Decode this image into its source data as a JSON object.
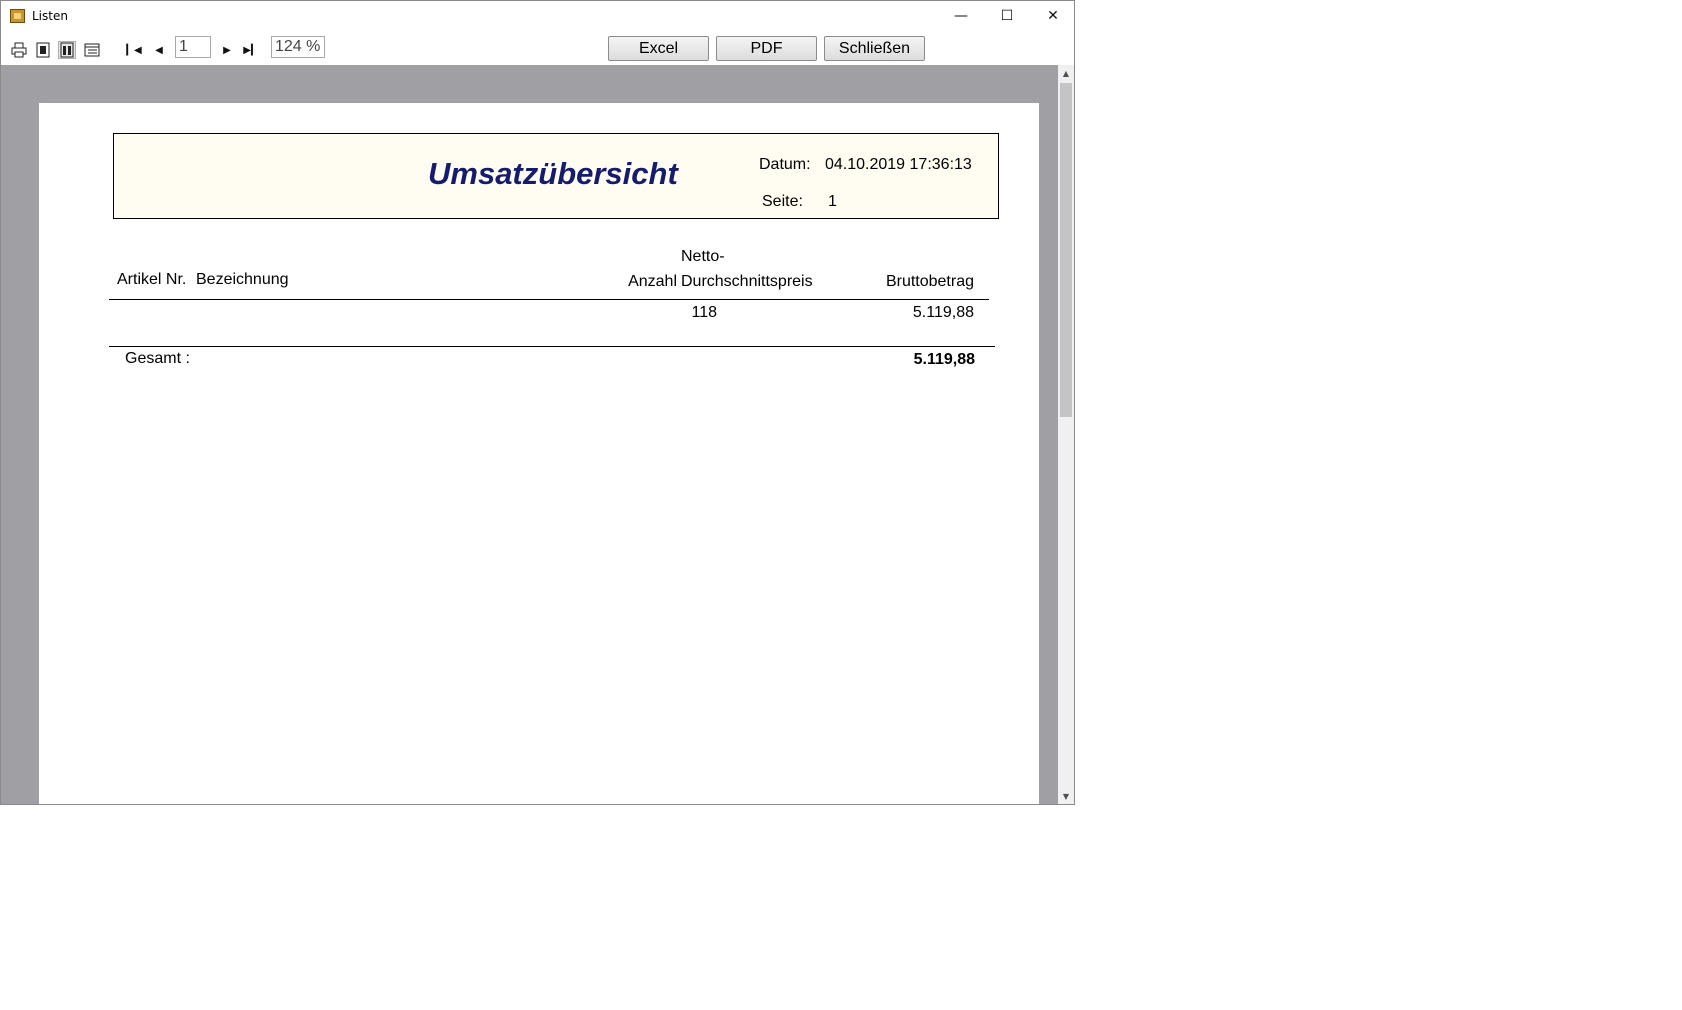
{
  "window": {
    "title": "Listen",
    "controls": {
      "minimize": "—",
      "maximize": "☐",
      "close": "✕"
    }
  },
  "toolbar": {
    "page_input": "1",
    "zoom": "124 %",
    "buttons": {
      "excel": "Excel",
      "pdf": "PDF",
      "close": "Schließen"
    },
    "icons": [
      "printer-icon",
      "single-page-icon",
      "two-page-icon",
      "list-view-icon",
      "first-page-icon",
      "prev-page-icon",
      "next-page-icon",
      "last-page-icon"
    ]
  },
  "report": {
    "title": "Umsatzübersicht",
    "date_label": "Datum:",
    "date_value": "04.10.2019 17:36:13",
    "page_label": "Seite:",
    "page_value": "1",
    "columns": {
      "article_no": "Artikel Nr.",
      "description": "Bezeichnung",
      "quantity": "Anzahl",
      "net_price_line1": "Netto-",
      "net_price_line2": "Durchschnittspreis",
      "gross": "Bruttobetrag"
    },
    "rows": [
      {
        "quantity": "118",
        "gross": "5.119,88"
      }
    ],
    "total_label": "Gesamt  :",
    "total_value": "5.119,88"
  },
  "colors": {
    "title": "#151b6e",
    "page_bg": "#a0a0a4",
    "header_box": "#fffdf2"
  }
}
